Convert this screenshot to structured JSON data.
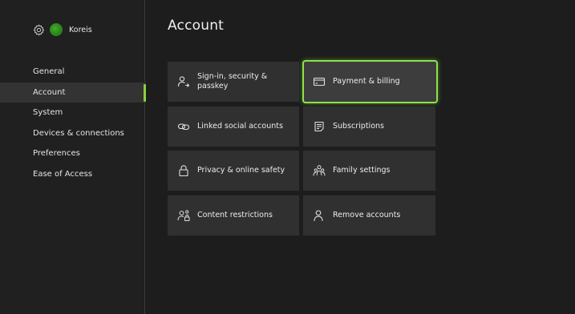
{
  "header": {
    "title": "Account"
  },
  "profile": {
    "gamertag": "Koreis",
    "icons": [
      "gear-icon",
      "avatar"
    ]
  },
  "sidebar": {
    "items": [
      {
        "label": "General",
        "active": false
      },
      {
        "label": "Account",
        "active": true
      },
      {
        "label": "System",
        "active": false
      },
      {
        "label": "Devices & connections",
        "active": false
      },
      {
        "label": "Preferences",
        "active": false
      },
      {
        "label": "Ease of Access",
        "active": false
      }
    ]
  },
  "tiles": [
    {
      "label": "Sign-in, security & passkey",
      "icon": "user-arrow-icon"
    },
    {
      "label": "Payment & billing",
      "icon": "credit-card-icon",
      "focused": true
    },
    {
      "label": "Linked social accounts",
      "icon": "link-icon"
    },
    {
      "label": "Subscriptions",
      "icon": "list-icon"
    },
    {
      "label": "Privacy & online safety",
      "icon": "lock-icon"
    },
    {
      "label": "Family settings",
      "icon": "family-icon"
    },
    {
      "label": "Content restrictions",
      "icon": "user-lock-icon"
    },
    {
      "label": "Remove accounts",
      "icon": "person-icon"
    }
  ],
  "colors": {
    "accent": "#86d23f",
    "background": "#1c1d1c",
    "tile": "#2f302f"
  }
}
